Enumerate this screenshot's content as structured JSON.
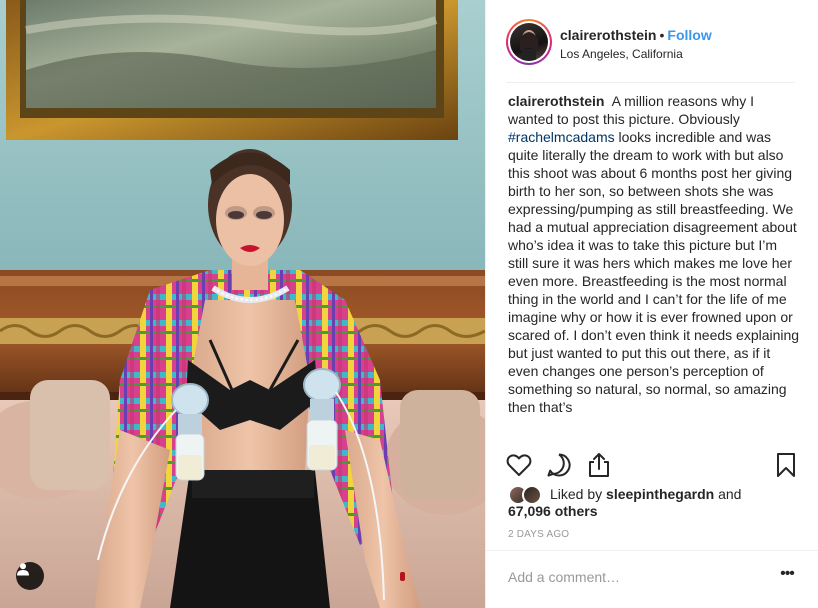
{
  "header": {
    "username": "clairerothstein",
    "separator": "•",
    "follow_label": "Follow",
    "location": "Los Angeles, California"
  },
  "caption": {
    "username": "clairerothstein",
    "text_before_tag": "A million reasons why I wanted to post this picture. Obviously",
    "hashtag": "#rachelmcadams",
    "text_after_tag": "looks incredible and was quite literally the dream to work with but also this shoot was about 6 months post her giving birth to her son, so between shots she was expressing/pumping as still breastfeeding. We had a mutual appreciation disagreement about who’s idea it was to take this picture but I’m still sure it was hers which makes me love her even more. Breastfeeding is the most normal thing in the world and I can’t for the life of me imagine why or how it is ever frowned upon or scared of. I don’t even think it needs explaining but just wanted to put this out there, as if it even changes one person’s perception of something so natural, so normal, so amazing then that’s"
  },
  "actions": {
    "like_icon": "heart-icon",
    "comment_icon": "comment-bubble-icon",
    "share_icon": "share-icon",
    "save_icon": "bookmark-icon"
  },
  "likes": {
    "prefix": "Liked by",
    "liked_by_user": "sleepinthegardn",
    "conjunction": "and",
    "others_count": "67,096 others"
  },
  "timestamp": "2 DAYS AGO",
  "comment": {
    "placeholder": "Add a comment…",
    "more_label": "•••"
  },
  "colors": {
    "accent_blue": "#3897f0",
    "hashtag_blue": "#003569",
    "text": "#262626",
    "muted": "#999999",
    "border": "#efefef"
  }
}
